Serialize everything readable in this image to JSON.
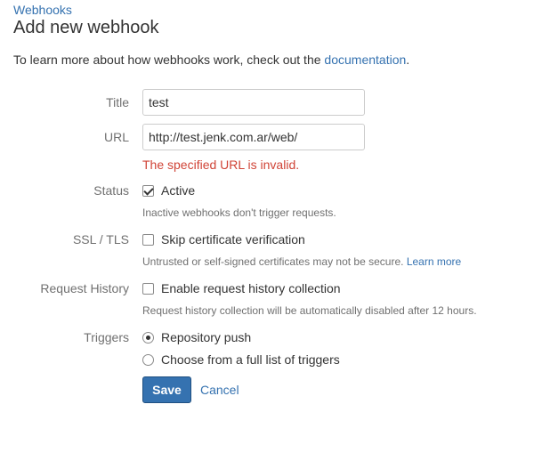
{
  "breadcrumb": {
    "label": "Webhooks"
  },
  "page": {
    "title": "Add new webhook"
  },
  "intro": {
    "text": "To learn more about how webhooks work, check out the ",
    "link": "documentation",
    "suffix": "."
  },
  "form": {
    "title": {
      "label": "Title",
      "value": "test"
    },
    "url": {
      "label": "URL",
      "value": "http://test.jenk.com.ar/web/",
      "error": "The specified URL is invalid."
    },
    "status": {
      "label": "Status",
      "option": "Active",
      "checked": true,
      "help": "Inactive webhooks don't trigger requests."
    },
    "ssl": {
      "label": "SSL / TLS",
      "option": "Skip certificate verification",
      "checked": false,
      "help": "Untrusted or self-signed certificates may not be secure. ",
      "help_link": "Learn more"
    },
    "history": {
      "label": "Request History",
      "option": "Enable request history collection",
      "checked": false,
      "help": "Request history collection will be automatically disabled after 12 hours."
    },
    "triggers": {
      "label": "Triggers",
      "options": [
        {
          "label": "Repository push",
          "selected": true
        },
        {
          "label": "Choose from a full list of triggers",
          "selected": false
        }
      ]
    }
  },
  "actions": {
    "save_label": "Save",
    "cancel_label": "Cancel"
  },
  "colors": {
    "link": "#3572b0",
    "primary_button": "#3572b0",
    "error": "#d04437",
    "label": "#707070"
  },
  "icons": {
    "status_checkbox": "checkbox-checked-icon",
    "ssl_checkbox": "checkbox-unchecked-icon",
    "history_checkbox": "checkbox-unchecked-icon",
    "trigger_radio_selected": "radio-selected-icon",
    "trigger_radio_unselected": "radio-unselected-icon"
  }
}
